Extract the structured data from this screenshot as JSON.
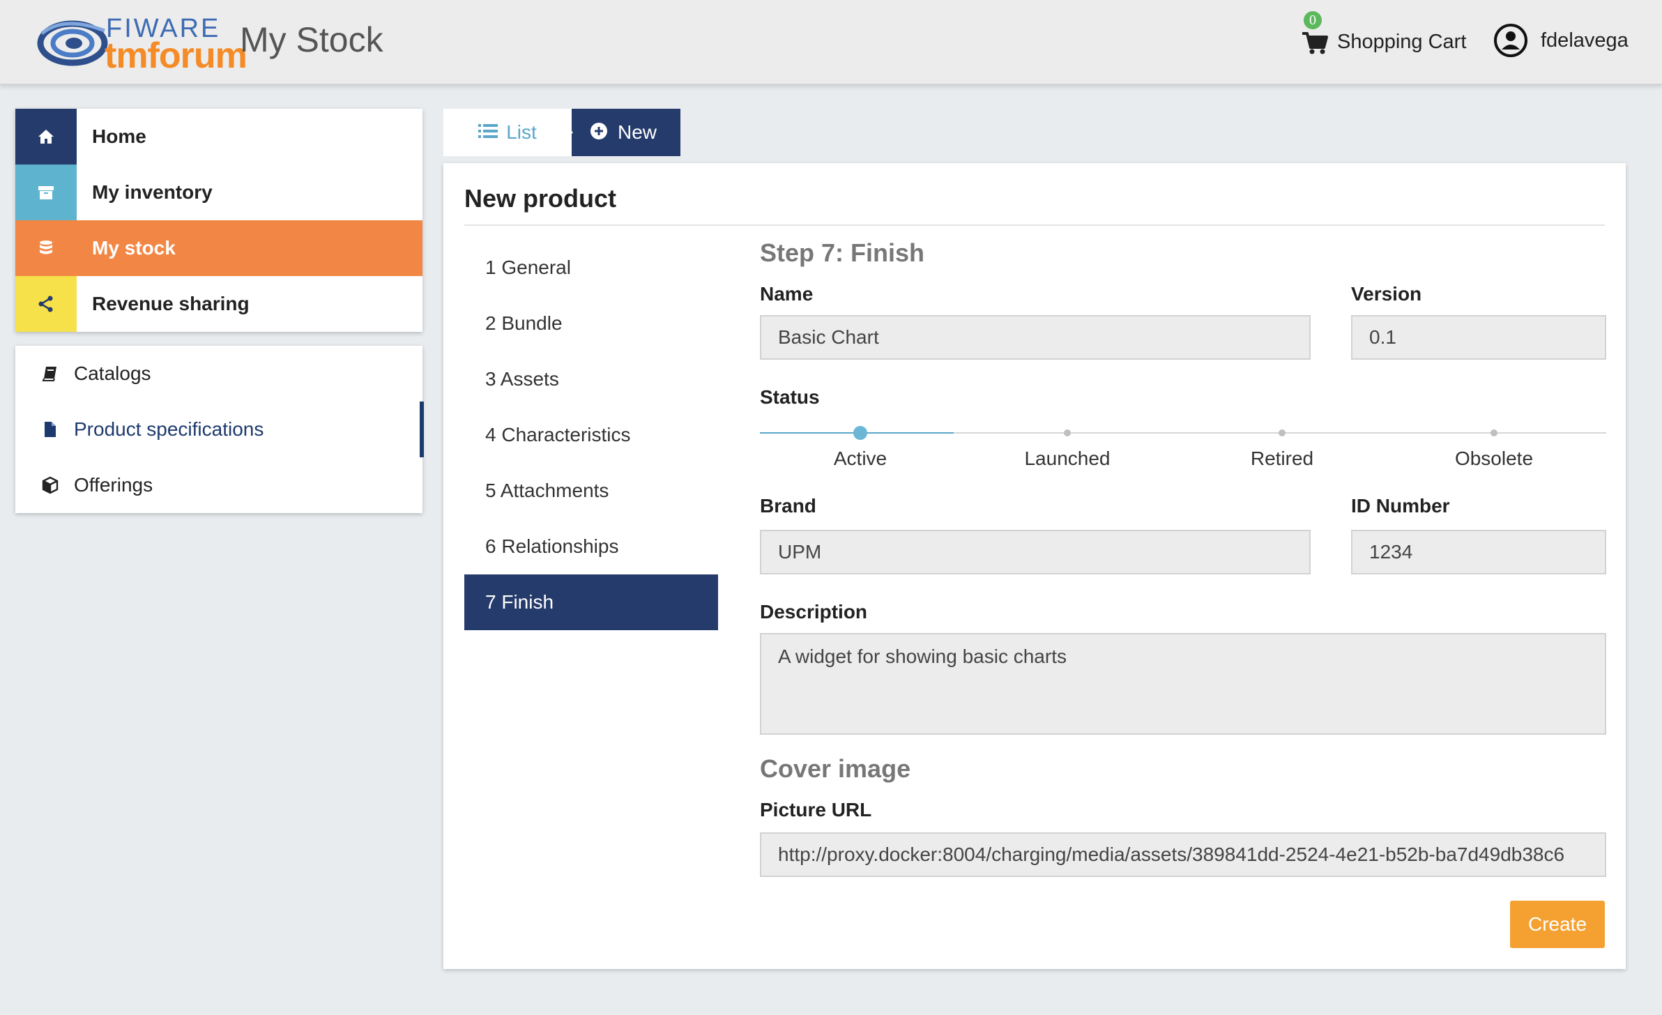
{
  "header": {
    "logo_top": "FIWARE",
    "logo_bottom": "tmforum",
    "title": "My Stock",
    "cart_count": "0",
    "cart_label": "Shopping Cart",
    "username": "fdelavega"
  },
  "sidebar": {
    "main_items": [
      {
        "label": "Home",
        "icon": "home-icon",
        "color": "#253b6b"
      },
      {
        "label": "My inventory",
        "icon": "archive-icon",
        "color": "#5eb3cf"
      },
      {
        "label": "My stock",
        "icon": "database-icon",
        "color": "#f28745"
      },
      {
        "label": "Revenue sharing",
        "icon": "share-icon",
        "color": "#f6e14b"
      }
    ],
    "sub_items": [
      {
        "label": "Catalogs",
        "icon": "book-icon"
      },
      {
        "label": "Product specifications",
        "icon": "file-icon"
      },
      {
        "label": "Offerings",
        "icon": "cube-icon"
      }
    ]
  },
  "tabs": {
    "list_label": "List",
    "new_label": "New"
  },
  "card": {
    "title": "New product",
    "steps": [
      "1 General",
      "2 Bundle",
      "3 Assets",
      "4 Characteristics",
      "5 Attachments",
      "6 Relationships",
      "7 Finish"
    ],
    "active_step": 7
  },
  "form": {
    "step_title": "Step 7: Finish",
    "name_label": "Name",
    "name_value": "Basic Chart",
    "version_label": "Version",
    "version_value": "0.1",
    "status_label": "Status",
    "status_options": [
      "Active",
      "Launched",
      "Retired",
      "Obsolete"
    ],
    "status_selected": "Active",
    "brand_label": "Brand",
    "brand_value": "UPM",
    "id_label": "ID Number",
    "id_value": "1234",
    "description_label": "Description",
    "description_value": "A widget for showing basic charts",
    "cover_title": "Cover image",
    "picture_label": "Picture URL",
    "picture_value": "http://proxy.docker:8004/charging/media/assets/389841dd-2524-4e21-b52b-ba7d49db38c6",
    "create_label": "Create"
  },
  "colors": {
    "navy": "#253b6b",
    "orange_active": "#f28745",
    "create_button": "#f4a132",
    "status_accent": "#5aa7c9"
  }
}
